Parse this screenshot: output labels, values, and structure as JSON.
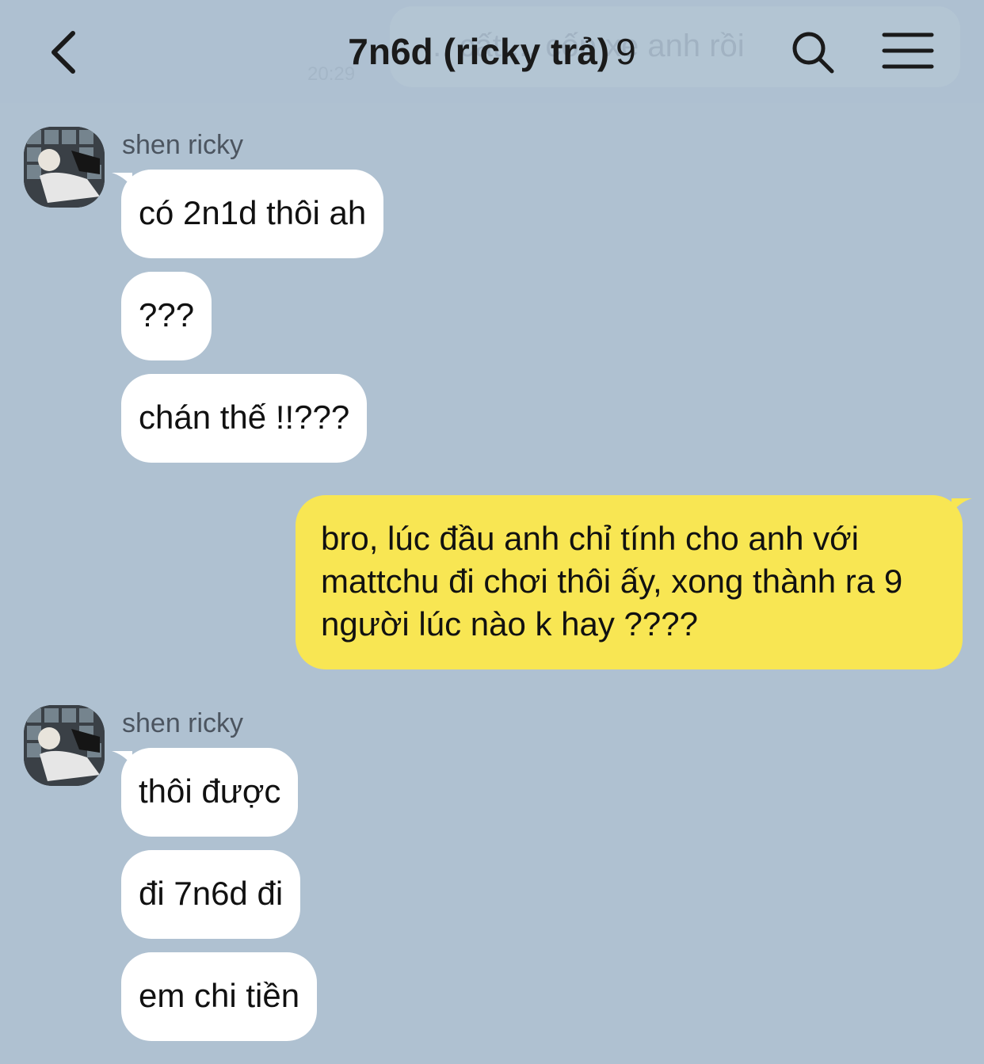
{
  "header": {
    "title": "7n6d (ricky trả)",
    "member_count": "9",
    "back_icon": "chevron-left-icon",
    "search_icon": "search-icon",
    "menu_icon": "hamburger-menu-icon",
    "ghost_notice": "... cất ... cốp xe anh rồi",
    "ghost_time": "20:29"
  },
  "messages": [
    {
      "sender": "shen ricky",
      "items": [
        "có 2n1d thôi ah",
        "???",
        "chán thế !!???"
      ]
    },
    {
      "mine": true,
      "text": "bro, lúc đầu anh chỉ tính cho anh với mattchu đi chơi thôi ấy, xong thành ra 9 người lúc nào k hay ????"
    },
    {
      "sender": "shen ricky",
      "items": [
        "thôi được",
        "đi 7n6d đi",
        "em chi tiền"
      ]
    }
  ],
  "colors": {
    "background": "#afc1d1",
    "incoming_bubble": "#ffffff",
    "outgoing_bubble": "#f8e653"
  }
}
